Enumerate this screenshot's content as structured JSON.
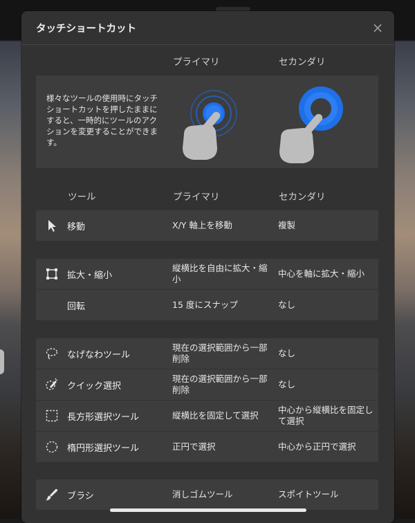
{
  "dialog": {
    "title": "タッチショートカット",
    "close_label": "×"
  },
  "columns": {
    "primary": "プライマリ",
    "secondary": "セカンダリ"
  },
  "intro": {
    "text": "様々なツールの使用時にタッチショートカットを押したままにすると、一時的にツールのアクションを変更することができます。"
  },
  "table": {
    "tool_header": "ツール",
    "primary_header": "プライマリ",
    "secondary_header": "セカンダリ",
    "groups": [
      [
        {
          "name": "移動",
          "primary": "X/Y 軸上を移動",
          "secondary": "複製",
          "icon": "move-arrow-icon"
        }
      ],
      [
        {
          "name": "拡大・縮小",
          "primary": "縦横比を自由に拡大・縮小",
          "secondary": "中心を軸に拡大・縮小",
          "icon": "transform-icon"
        },
        {
          "name": "回転",
          "primary": "15 度にスナップ",
          "secondary": "なし",
          "icon": ""
        }
      ],
      [
        {
          "name": "なげなわツール",
          "primary": "現在の選択範囲から一部削除",
          "secondary": "なし",
          "icon": "lasso-icon"
        },
        {
          "name": "クイック選択",
          "primary": "現在の選択範囲から一部削除",
          "secondary": "なし",
          "icon": "quick-select-icon"
        },
        {
          "name": "長方形選択ツール",
          "primary": "縦横比を固定して選択",
          "secondary": "中心から縦横比を固定して選択",
          "icon": "rect-select-icon"
        },
        {
          "name": "楕円形選択ツール",
          "primary": "正円で選択",
          "secondary": "中心から正円で選択",
          "icon": "ellipse-select-icon"
        }
      ],
      [
        {
          "name": "ブラシ",
          "primary": "消しゴムツール",
          "secondary": "スポイトツール",
          "icon": "brush-icon"
        }
      ]
    ]
  },
  "colors": {
    "accent_blue": "#1f6fe8",
    "hand_gray": "#bdbdbd"
  }
}
